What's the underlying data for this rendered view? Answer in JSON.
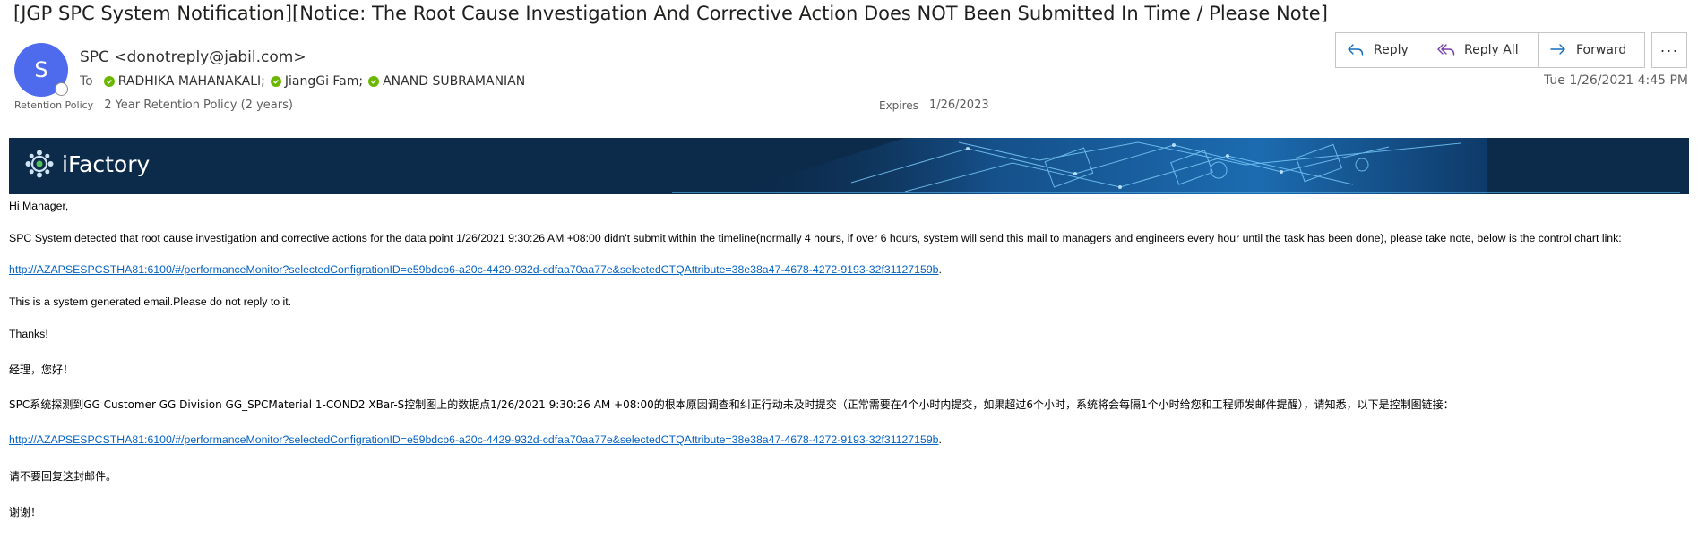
{
  "email": {
    "subject": "[JGP SPC System Notification][Notice: The Root Cause Investigation And Corrective Action Does NOT Been Submitted In Time / Please Note]",
    "sender": {
      "initial": "S",
      "display": "SPC <donotreply@jabil.com>"
    },
    "to_label": "To",
    "recipients": [
      "RADHIKA MAHANAKALI;",
      "JiangGi Fam;",
      "ANAND SUBRAMANIAN"
    ],
    "retention_label": "Retention Policy",
    "retention_value": "2 Year Retention Policy (2 years)",
    "expires_label": "Expires",
    "expires_value": "1/26/2023",
    "timestamp": "Tue 1/26/2021 4:45 PM"
  },
  "actions": {
    "reply": "Reply",
    "reply_all": "Reply All",
    "forward": "Forward",
    "more": "···"
  },
  "banner": {
    "title": "iFactory"
  },
  "body": {
    "greeting": "Hi Manager,",
    "message": "SPC System detected that root cause investigation and corrective actions for the data point 1/26/2021 9:30:26 AM +08:00 didn't submit within the timeline(normally 4 hours, if over 6 hours, system will send this mail to managers and engineers every hour until the task has been done), please take note, below is the control chart link:",
    "link": "http://AZAPSESPCSTHA81:6100/#/performanceMonitor?selectedConfigrationID=e59bdcb6-a20c-4429-932d-cdfaa70aa77e&selectedCTQAttribute=38e38a47-4678-4272-9193-32f31127159b",
    "link_suffix": ".",
    "system_note": "This is a system generated email.Please do not reply to it.",
    "thanks": "Thanks!",
    "cn_greeting": "经理，您好！",
    "cn_message": "SPC系统探测到GG Customer GG Division GG_SPCMaterial 1-COND2 XBar-S控制图上的数据点1/26/2021 9:30:26 AM +08:00的根本原因调查和纠正行动未及时提交（正常需要在4个小时内提交，如果超过6个小时，系统将会每隔1个小时给您和工程师发邮件提醒），请知悉，以下是控制图链接：",
    "cn_link": "http://AZAPSESPCSTHA81:6100/#/performanceMonitor?selectedConfigrationID=e59bdcb6-a20c-4429-932d-cdfaa70aa77e&selectedCTQAttribute=38e38a47-4678-4272-9193-32f31127159b",
    "cn_link_suffix": ".",
    "cn_no_reply": "请不要回复这封邮件。",
    "cn_thanks": "谢谢！"
  },
  "colors": {
    "avatar": "#4f6bed",
    "status_available": "#6bb700",
    "link": "#0563c1",
    "banner": "#0c2a4a"
  },
  "icons": {
    "reply": "reply-arrow-icon",
    "reply_all": "reply-all-arrow-icon",
    "forward": "forward-arrow-icon",
    "more": "ellipsis-icon",
    "presence": "available-check-icon",
    "logo": "ifactory-gear-logo"
  }
}
